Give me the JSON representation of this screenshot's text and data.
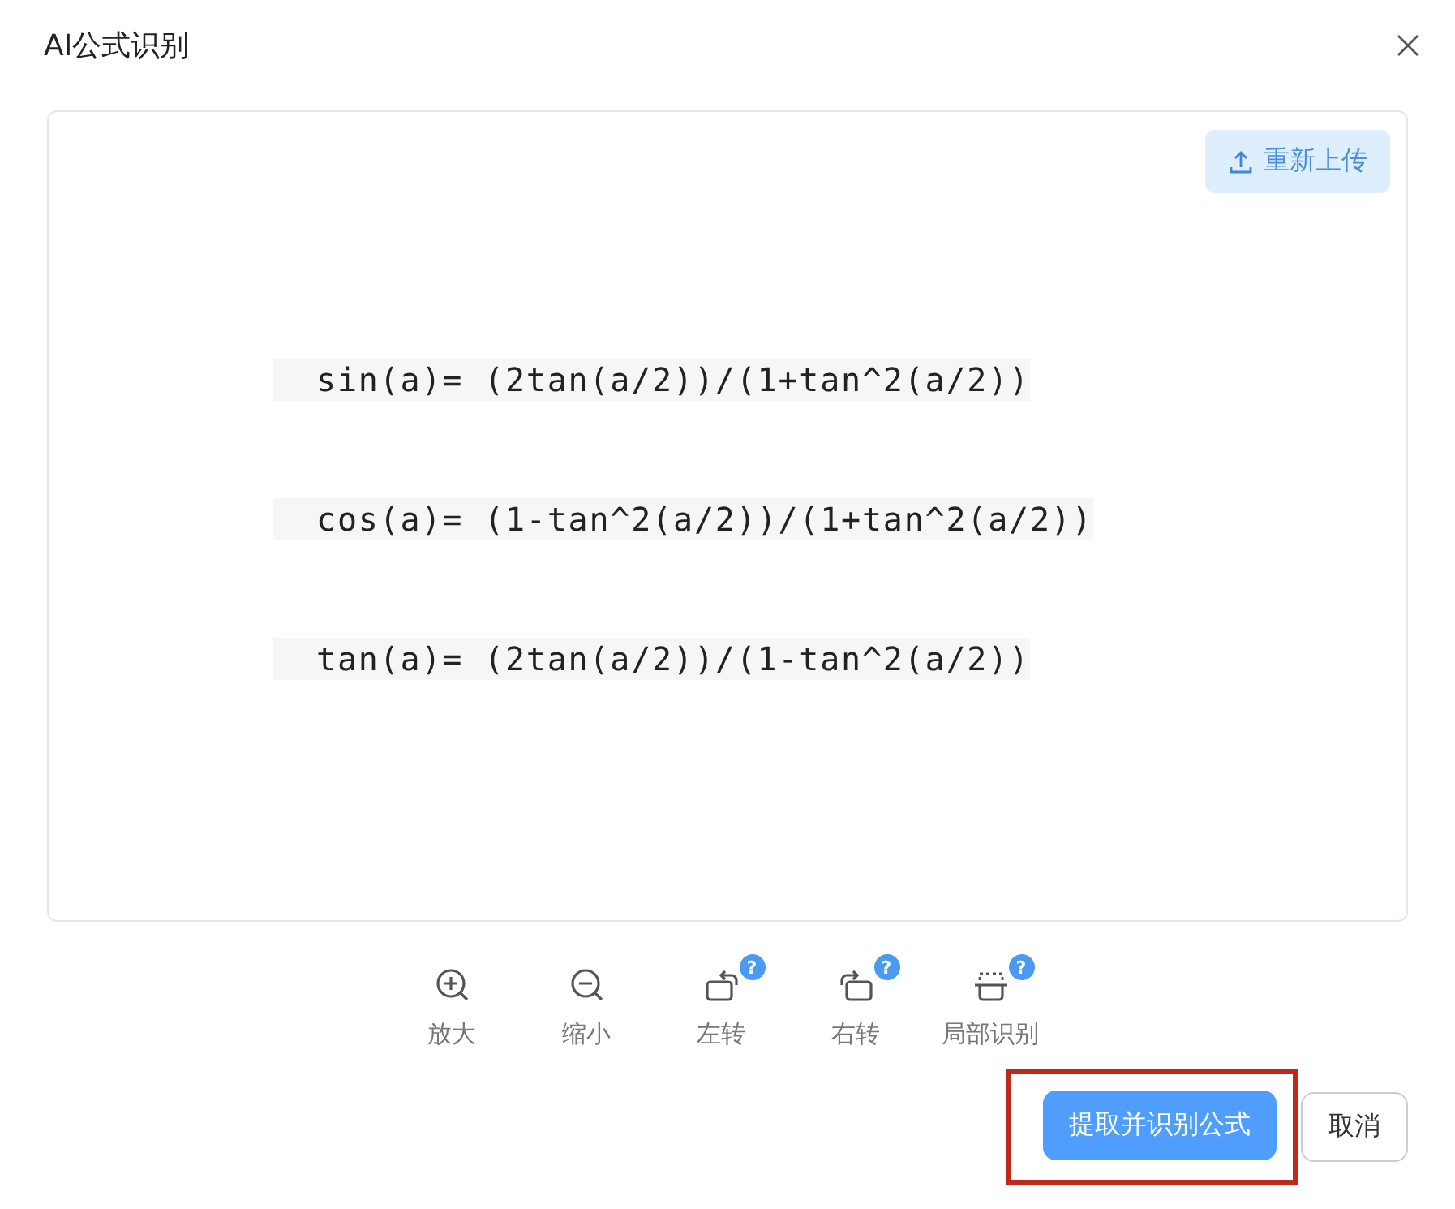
{
  "dialog": {
    "title": "AI公式识别"
  },
  "preview": {
    "reupload": "重新上传",
    "formulas": [
      "sin(a)= (2tan(a/2))/(1+tan^2(a/2))",
      "cos(a)= (1-tan^2(a/2))/(1+tan^2(a/2))",
      "tan(a)= (2tan(a/2))/(1-tan^2(a/2))"
    ]
  },
  "tools": [
    {
      "kind": "zoom-in",
      "label": "放大"
    },
    {
      "kind": "zoom-out",
      "label": "缩小"
    },
    {
      "kind": "rotate-left",
      "label": "左转",
      "help": "?"
    },
    {
      "kind": "rotate-right",
      "label": "右转",
      "help": "?"
    },
    {
      "kind": "crop",
      "label": "局部识别",
      "help": "?"
    }
  ],
  "buttons": [
    {
      "kind": "primary",
      "label": "提取并识别公式",
      "highlighted": true
    },
    {
      "kind": "secondary",
      "label": "取消",
      "highlighted": false
    }
  ]
}
